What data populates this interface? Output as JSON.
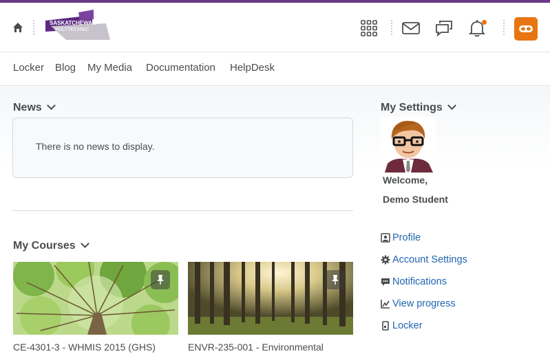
{
  "header": {
    "logo_line1": "SASKATCHEWAN",
    "logo_line2": "POLYTECHNIC",
    "icons": [
      "home-icon",
      "waffle-grid-icon",
      "mail-icon",
      "chat-icon",
      "bell-icon",
      "user-avatar-icon"
    ],
    "notification_dot_color": "#e87511",
    "avatar_color": "#e87511",
    "brand_stripe_color": "#6b3a87"
  },
  "nav": {
    "items": [
      "Locker",
      "Blog",
      "My Media",
      "Documentation",
      "HelpDesk"
    ]
  },
  "news": {
    "title": "News",
    "empty_message": "There is no news to display."
  },
  "courses": {
    "title": "My Courses",
    "items": [
      {
        "title": "CE-4301-3 - WHMIS 2015 (GHS)",
        "image": "tree-canopy-image",
        "pin_icon": "pin-icon"
      },
      {
        "title": "ENVR-235-001 - Environmental",
        "image": "forest-sunlight-image",
        "pin_icon": "pin-icon"
      }
    ]
  },
  "settings": {
    "title": "My Settings",
    "welcome": "Welcome,",
    "user_name": "Demo Student",
    "links": [
      {
        "label": "Profile",
        "icon": "profile-card-icon"
      },
      {
        "label": "Account Settings",
        "icon": "gear-icon"
      },
      {
        "label": "Notifications",
        "icon": "speech-bubble-icon"
      },
      {
        "label": "View progress",
        "icon": "chart-icon"
      },
      {
        "label": "Locker",
        "icon": "locker-icon"
      }
    ],
    "link_color": "#1f65b0"
  }
}
